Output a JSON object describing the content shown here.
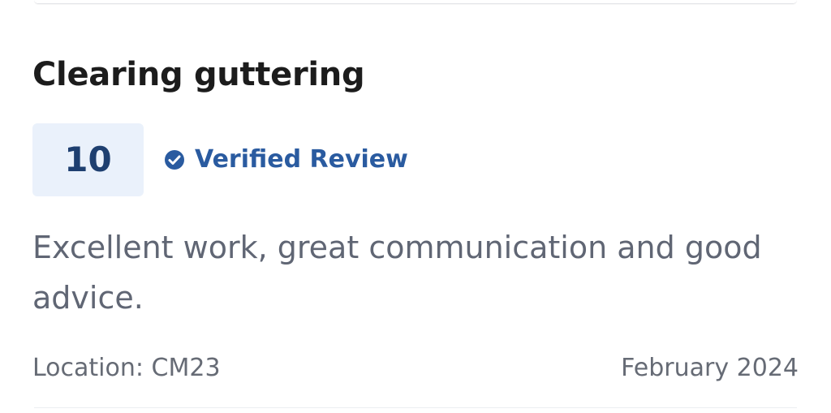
{
  "review": {
    "title": "Clearing guttering",
    "score": "10",
    "verified_label": "Verified Review",
    "body": "Excellent work, great communication and good advice.",
    "location": "Location: CM23",
    "date": "February 2024"
  },
  "icons": {
    "verified": "verified-check-icon"
  },
  "colors": {
    "score_bg": "#eaf1fb",
    "score_text": "#1e3f70",
    "verified_text": "#2a5ba0",
    "body_text": "#606674"
  }
}
